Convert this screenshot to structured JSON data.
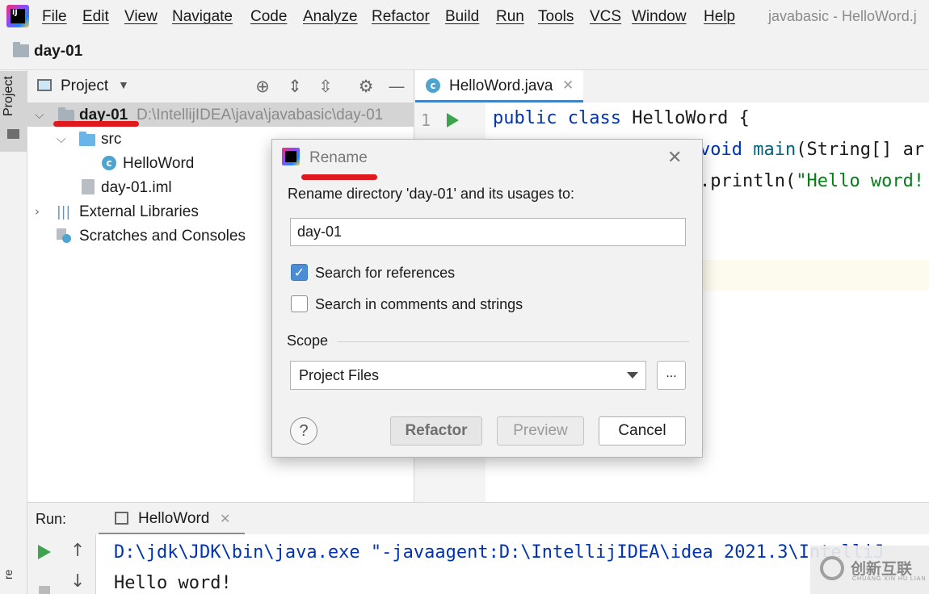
{
  "window_title": "javabasic - HelloWord.j",
  "menu": [
    "File",
    "Edit",
    "View",
    "Navigate",
    "Code",
    "Analyze",
    "Refactor",
    "Build",
    "Run",
    "Tools",
    "VCS",
    "Window",
    "Help"
  ],
  "breadcrumb": {
    "label": "day-01"
  },
  "left_strip": {
    "tab_label": "Project",
    "bottom_label": "re"
  },
  "project_panel": {
    "title": "Project",
    "tree": {
      "root_name": "day-01",
      "root_path": "D:\\IntellijIDEA\\java\\javabasic\\day-01",
      "src": "src",
      "class_name": "HelloWord",
      "iml": "day-01.iml",
      "external": "External Libraries",
      "scratches": "Scratches and Consoles"
    }
  },
  "editor": {
    "tab_label": "HelloWord.java",
    "line_number": "1",
    "code": {
      "l1_kw": "public class",
      "l1_rest": " HelloWord {",
      "l2_kw": "void",
      "l2_fn": " main",
      "l2_rest": "(String[] ar",
      "l3_rest": ".println(",
      "l3_str": "\"Hello word!"
    }
  },
  "run_panel": {
    "label": "Run:",
    "tab_label": "HelloWord",
    "console": [
      "D:\\jdk\\JDK\\bin\\java.exe \"-javaagent:D:\\IntellijIDEA\\idea 2021.3\\IntelliJ",
      "Hello word!"
    ]
  },
  "watermark": {
    "text": "创新互联",
    "sub": "CHUANG XIN HU LIAN"
  },
  "dialog": {
    "title": "Rename",
    "prompt": "Rename directory 'day-01' and its usages to:",
    "input_value": "day-01",
    "search_refs_label": "Search for references",
    "search_refs_checked": true,
    "search_comments_label": "Search in comments and strings",
    "search_comments_checked": false,
    "scope_label": "Scope",
    "scope_value": "Project Files",
    "more_label": "...",
    "help_label": "?",
    "buttons": {
      "refactor": "Refactor",
      "preview": "Preview",
      "cancel": "Cancel"
    }
  },
  "colors": {
    "annotation_red": "#e0191f",
    "accent_blue": "#4a8dd6",
    "run_green": "#3ea34d",
    "keyword": "#0033b3",
    "string": "#067d17"
  }
}
